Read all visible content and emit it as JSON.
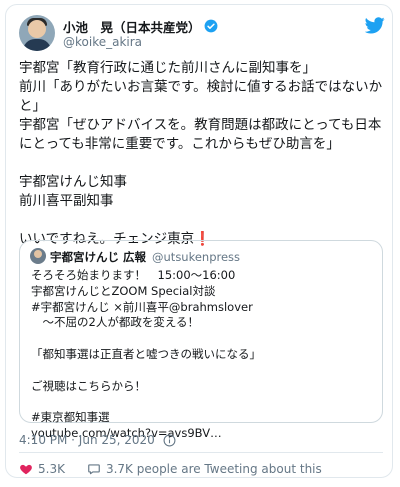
{
  "author": {
    "name": "小池　晃（日本共産党）",
    "handle": "@koike_akira"
  },
  "tweet": {
    "body": "宇都宮「教育行政に通じた前川さんに副知事を」\n前川「ありがたいお言葉です。検討に値するお話ではないかと」\n宇都宮「ぜひアドバイスを。教育問題は都政にとっても日本にとっても非常に重要です。これからもぜひ助言を」\n\n宇都宮けんじ知事\n前川喜平副知事\n\nいいですねえ。チェンジ東京",
    "exclaim": "❗"
  },
  "quoted": {
    "name": "宇都宮けんじ 広報",
    "handle": "@utsukenpress",
    "body": "そろそろ始まります！　15:00〜16:00\n宇都宮けんじとZOOM Special対談\n#宇都宮けんじ ×前川喜平@brahmslover\n　〜不屈の2人が都政を変える！\n\n「都知事選は正直者と嘘つきの戦いになる」\n\nご視聴はこちらから！\n\n#東京都知事選\nyoutube.com/watch?v=avs9BV…"
  },
  "meta": {
    "timestamp": "4:10 PM · Jun 25, 2020"
  },
  "actions": {
    "like_count": "5.3K",
    "tweeting_text": "3.7K people are Tweeting about this"
  },
  "colors": {
    "twitter_blue": "#1da1f2",
    "like_red": "#e0245e",
    "secondary_text": "#657786"
  }
}
